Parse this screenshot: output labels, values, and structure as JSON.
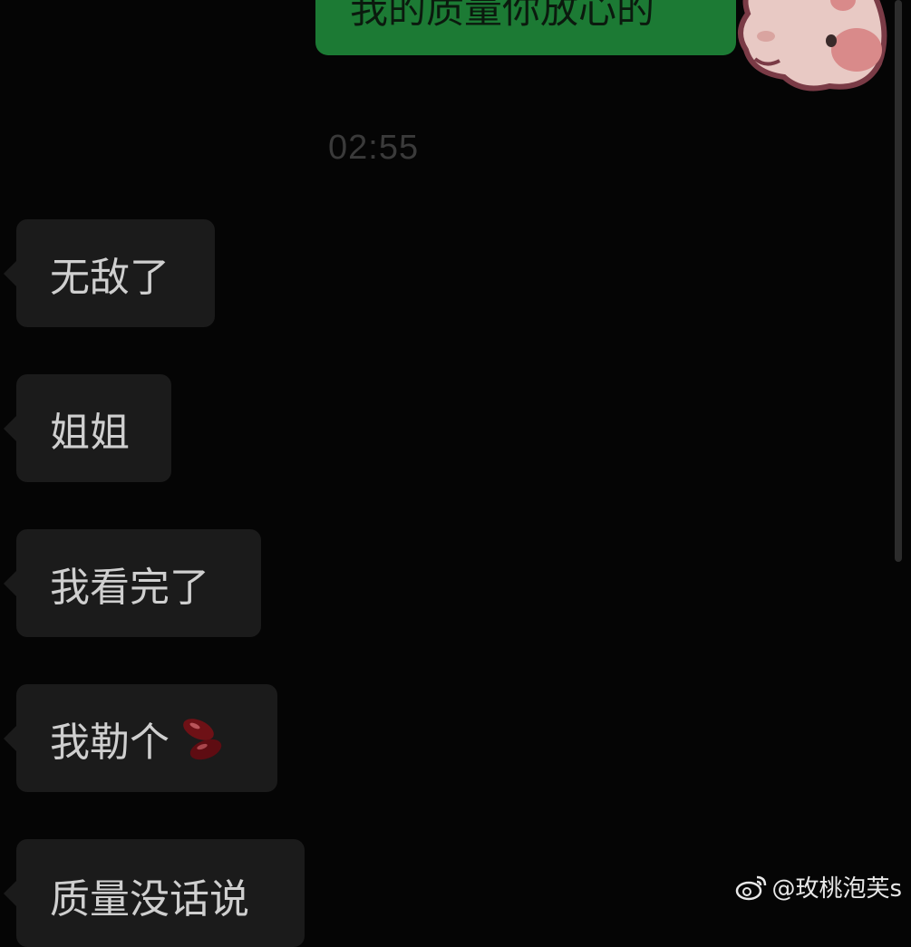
{
  "sent_message": {
    "text": "我的质量你放心的"
  },
  "timestamp": "02:55",
  "received_messages": [
    {
      "text": "无敌了"
    },
    {
      "text": "姐姐"
    },
    {
      "text": "我看完了"
    },
    {
      "text": "我勒个",
      "emoji": "bean-icon"
    },
    {
      "text": "质量没话说"
    }
  ],
  "watermark": {
    "text": "@玫桃泡芙s",
    "icon": "weibo-icon"
  },
  "colors": {
    "background": "#050505",
    "sent_bubble": "#1c7a34",
    "received_bubble": "#1b1b1b",
    "timestamp": "#3a3a3a"
  }
}
